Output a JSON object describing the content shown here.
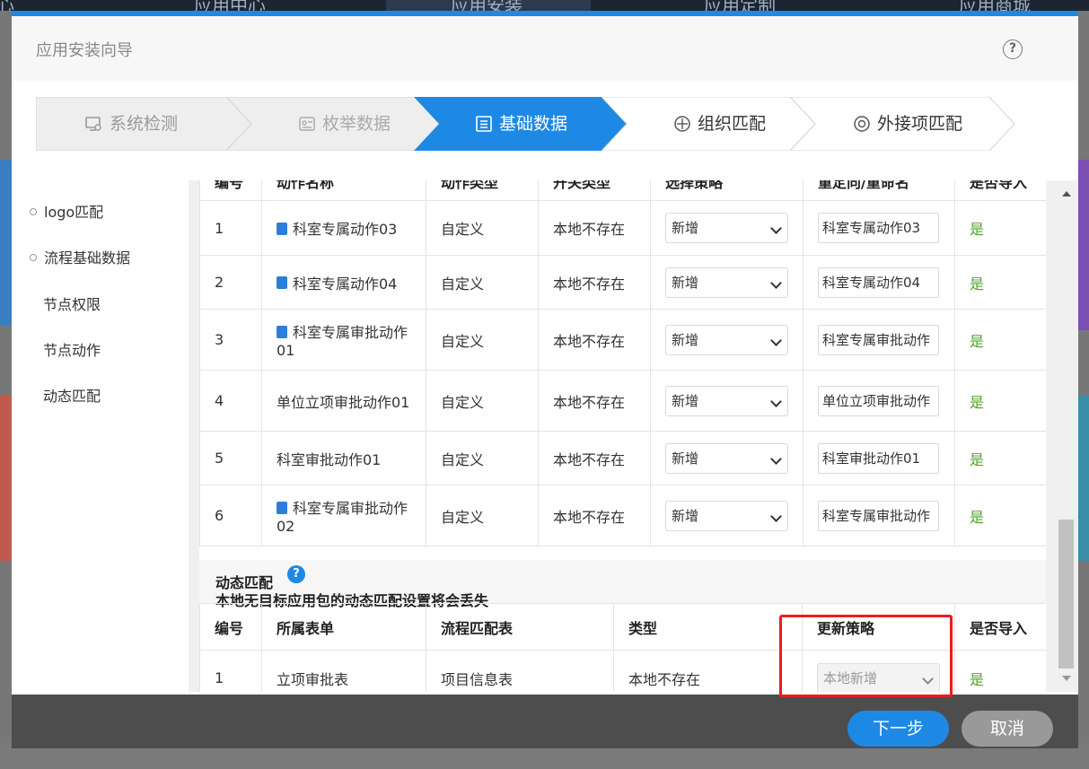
{
  "background": {
    "nav_items": [
      "心",
      "应用中心",
      "应用安装",
      "应用定制",
      "应用商城"
    ]
  },
  "dialog": {
    "title": "应用安装向导"
  },
  "steps": [
    {
      "label": "系统检测",
      "state": "done",
      "icon": "monitor-check-icon"
    },
    {
      "label": "枚举数据",
      "state": "done",
      "icon": "enum-data-icon"
    },
    {
      "label": "基础数据",
      "state": "active",
      "icon": "document-list-icon"
    },
    {
      "label": "组织匹配",
      "state": "pending",
      "icon": "org-match-icon"
    },
    {
      "label": "外接项匹配",
      "state": "pending",
      "icon": "external-item-icon"
    }
  ],
  "leftnav": {
    "items": [
      {
        "label": "logo匹配",
        "dot": true
      },
      {
        "label": "流程基础数据",
        "dot": true
      },
      {
        "label": "节点权限",
        "dot": false
      },
      {
        "label": "节点动作",
        "dot": false
      },
      {
        "label": "动态匹配",
        "dot": false
      }
    ]
  },
  "actions_table": {
    "columns": [
      "编号",
      "动作名称",
      "动作类型",
      "开关类型",
      "选择策略",
      "重定向/重命名",
      "是否导入"
    ],
    "rows": [
      {
        "no": "1",
        "name": "科室专属动作03",
        "icon": true,
        "type": "自定义",
        "status": "本地不存在",
        "strategy": "新增",
        "rename": "科室专属动作03",
        "import": "是"
      },
      {
        "no": "2",
        "name": "科室专属动作04",
        "icon": true,
        "type": "自定义",
        "status": "本地不存在",
        "strategy": "新增",
        "rename": "科室专属动作04",
        "import": "是"
      },
      {
        "no": "3",
        "name": "科室专属审批动作01",
        "icon": true,
        "type": "自定义",
        "status": "本地不存在",
        "strategy": "新增",
        "rename": "科室专属审批动作",
        "import": "是"
      },
      {
        "no": "4",
        "name": "单位立项审批动作01",
        "icon": false,
        "type": "自定义",
        "status": "本地不存在",
        "strategy": "新增",
        "rename": "单位立项审批动作",
        "import": "是"
      },
      {
        "no": "5",
        "name": "科室审批动作01",
        "icon": false,
        "type": "自定义",
        "status": "本地不存在",
        "strategy": "新增",
        "rename": "科室审批动作01",
        "import": "是"
      },
      {
        "no": "6",
        "name": "科室专属审批动作02",
        "icon": true,
        "type": "自定义",
        "status": "本地不存在",
        "strategy": "新增",
        "rename": "科室专属审批动作",
        "import": "是"
      }
    ]
  },
  "dynamic_section": {
    "title": "动态匹配",
    "help_icon": "?",
    "note": "本地无目标应用包的动态匹配设置将会丢失",
    "columns": [
      "编号",
      "所属表单",
      "流程匹配表",
      "类型",
      "更新策略",
      "是否导入"
    ],
    "rows": [
      {
        "no": "1",
        "form": "立项审批表",
        "match_table": "项目信息表",
        "type": "本地不存在",
        "strategy": "本地新增",
        "import": "是"
      }
    ]
  },
  "footer": {
    "next_label": "下一步",
    "cancel_label": "取消"
  },
  "colors": {
    "accent": "#1e88e5",
    "yes": "#52a42c",
    "highlight": "#ee1c1c"
  }
}
